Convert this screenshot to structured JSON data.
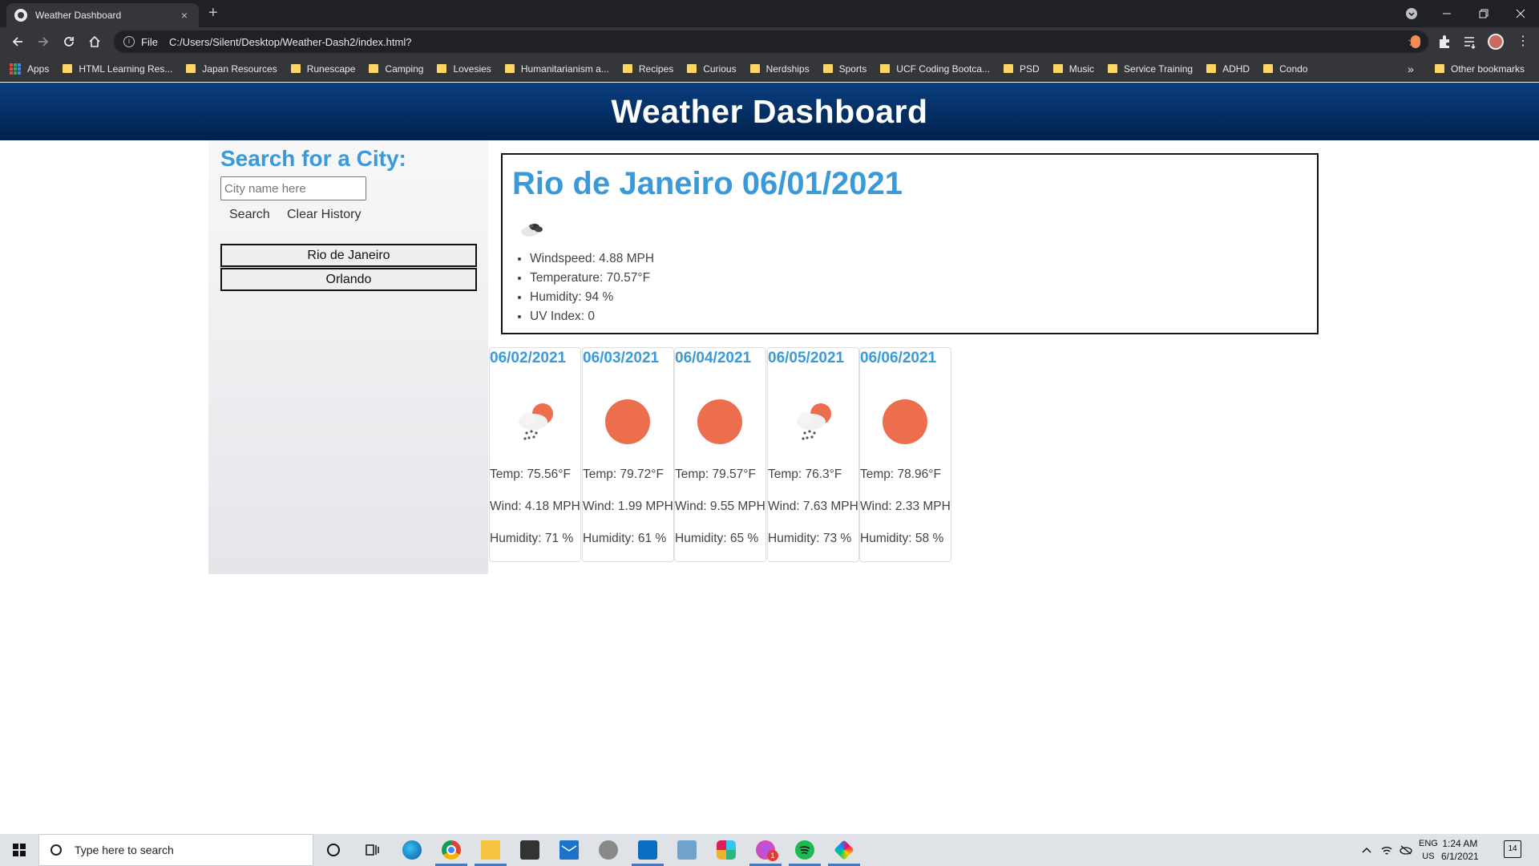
{
  "browser": {
    "tab_title": "Weather Dashboard",
    "tab_close": "×",
    "new_tab": "+",
    "scheme_label": "File",
    "url": "C:/Users/Silent/Desktop/Weather-Dash2/index.html?",
    "bookmarks": [
      "Apps",
      "HTML Learning Res...",
      "Japan Resources",
      "Runescape",
      "Camping",
      "Lovesies",
      "Humanitarianism a...",
      "Recipes",
      "Curious",
      "Nerdships",
      "Sports",
      "UCF Coding Bootca...",
      "PSD",
      "Music",
      "Service Training",
      "ADHD",
      "Condo"
    ],
    "bookmarks_overflow": "»",
    "other_bookmarks": "Other bookmarks"
  },
  "header": {
    "title": "Weather Dashboard"
  },
  "search": {
    "title": "Search for a City:",
    "placeholder": "City name here",
    "search_label": "Search",
    "clear_label": "Clear History",
    "history": [
      "Rio de Janeiro",
      "Orlando"
    ]
  },
  "current": {
    "heading": "Rio de Janeiro 06/01/2021",
    "icon": "broken-clouds-icon",
    "items": [
      "Windspeed: 4.88 MPH",
      "Temperature: 70.57°F",
      "Humidity: 94 %",
      "UV Index: 0"
    ]
  },
  "forecast": [
    {
      "date": "06/02/2021",
      "icon": "rain-sun-icon",
      "temp": "Temp: 75.56°F",
      "wind": "Wind: 4.18 MPH",
      "humidity": "Humidity: 71 %"
    },
    {
      "date": "06/03/2021",
      "icon": "sun-icon",
      "temp": "Temp: 79.72°F",
      "wind": "Wind: 1.99 MPH",
      "humidity": "Humidity: 61 %"
    },
    {
      "date": "06/04/2021",
      "icon": "sun-icon",
      "temp": "Temp: 79.57°F",
      "wind": "Wind: 9.55 MPH",
      "humidity": "Humidity: 65 %"
    },
    {
      "date": "06/05/2021",
      "icon": "rain-sun-icon",
      "temp": "Temp: 76.3°F",
      "wind": "Wind: 7.63 MPH",
      "humidity": "Humidity: 73 %"
    },
    {
      "date": "06/06/2021",
      "icon": "sun-icon",
      "temp": "Temp: 78.96°F",
      "wind": "Wind: 2.33 MPH",
      "humidity": "Humidity: 58 %"
    }
  ],
  "taskbar": {
    "search_placeholder": "Type here to search",
    "lang_top": "ENG",
    "lang_bottom": "US",
    "time": "1:24 AM",
    "date": "6/1/2021",
    "notification_count": "14",
    "badge_count": "1"
  },
  "colors": {
    "accent": "#3a9ad9",
    "header_top": "#0a3f7e",
    "header_bottom": "#00214d",
    "sun": "#ec6e4c"
  }
}
